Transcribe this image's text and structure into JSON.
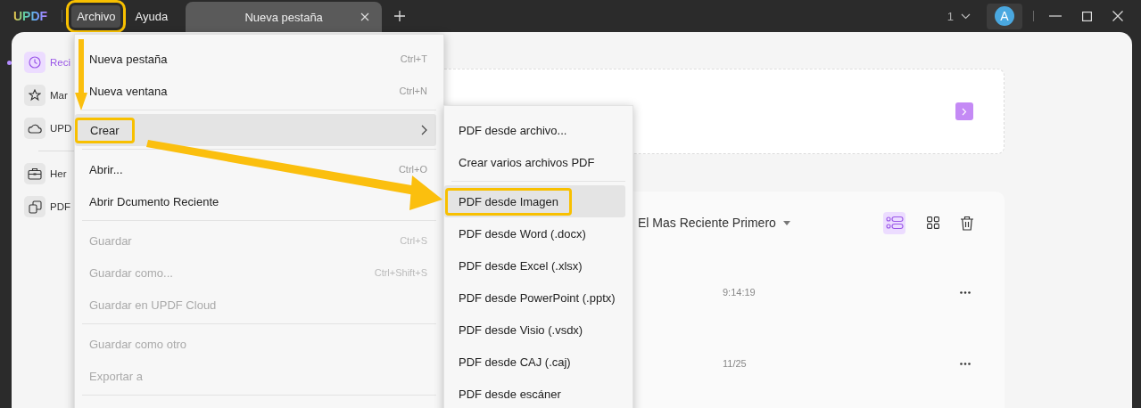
{
  "app": {
    "logo": "UPDF"
  },
  "menubar": [
    {
      "label": "Archivo",
      "selected": true,
      "annotated": true
    },
    {
      "label": "Ayuda",
      "selected": false,
      "annotated": false
    }
  ],
  "tabs": [
    {
      "label": "Nueva pestaña",
      "selected": true
    }
  ],
  "window": {
    "page_count": "1",
    "avatar": "A"
  },
  "sidebar": {
    "groups": [
      [
        {
          "label": "Reci",
          "kind": "clock",
          "selected": true
        },
        {
          "label": "Mar",
          "kind": "star",
          "selected": false
        },
        {
          "label": "UPD",
          "kind": "cloud",
          "selected": false
        }
      ],
      [
        {
          "label": "Her",
          "kind": "toolbox",
          "selected": false
        },
        {
          "label": "PDF",
          "kind": "copies",
          "selected": false
        }
      ]
    ]
  },
  "main": {
    "sort": "El Mas Reciente Primero",
    "view_modes": [
      {
        "kind": "list",
        "selected": true
      },
      {
        "kind": "grid",
        "selected": false
      }
    ],
    "files": [
      {
        "time": "9:14:19"
      },
      {
        "time": "11/25"
      }
    ]
  },
  "file_menu": [
    {
      "kind": "item",
      "label": "Nueva pestaña",
      "shortcut": "Ctrl+T",
      "disabled": false,
      "selected": false
    },
    {
      "kind": "item",
      "label": "Nueva ventana",
      "shortcut": "Ctrl+N",
      "disabled": false,
      "selected": false
    },
    {
      "kind": "divider"
    },
    {
      "kind": "item",
      "label": "Crear",
      "submenu": true,
      "disabled": false,
      "selected": true,
      "annotated": true
    },
    {
      "kind": "divider"
    },
    {
      "kind": "item",
      "label": "Abrir...",
      "shortcut": "Ctrl+O",
      "disabled": false,
      "selected": false
    },
    {
      "kind": "item",
      "label": "Abrir Dcumento Reciente",
      "disabled": false,
      "selected": false
    },
    {
      "kind": "divider"
    },
    {
      "kind": "item",
      "label": "Guardar",
      "shortcut": "Ctrl+S",
      "disabled": true,
      "selected": false
    },
    {
      "kind": "item",
      "label": "Guardar como...",
      "shortcut": "Ctrl+Shift+S",
      "disabled": true,
      "selected": false
    },
    {
      "kind": "item",
      "label": "Guardar en UPDF Cloud",
      "disabled": true,
      "selected": false
    },
    {
      "kind": "divider"
    },
    {
      "kind": "item",
      "label": "Guardar como otro",
      "disabled": true,
      "selected": false
    },
    {
      "kind": "item",
      "label": "Exportar a",
      "disabled": true,
      "selected": false
    },
    {
      "kind": "divider"
    }
  ],
  "create_submenu": [
    {
      "kind": "item",
      "label": "PDF desde archivo...",
      "selected": false
    },
    {
      "kind": "item",
      "label": "Crear varios archivos PDF",
      "selected": false
    },
    {
      "kind": "divider"
    },
    {
      "kind": "item",
      "label": "PDF desde Imagen",
      "selected": true,
      "annotated": true
    },
    {
      "kind": "item",
      "label": "PDF desde Word (.docx)",
      "selected": false
    },
    {
      "kind": "item",
      "label": "PDF desde Excel (.xlsx)",
      "selected": false
    },
    {
      "kind": "item",
      "label": "PDF desde PowerPoint (.pptx)",
      "selected": false
    },
    {
      "kind": "item",
      "label": "PDF desde Visio (.vsdx)",
      "selected": false
    },
    {
      "kind": "item",
      "label": "PDF desde CAJ (.caj)",
      "selected": false
    },
    {
      "kind": "item",
      "label": "PDF desde escáner",
      "selected": false
    }
  ]
}
